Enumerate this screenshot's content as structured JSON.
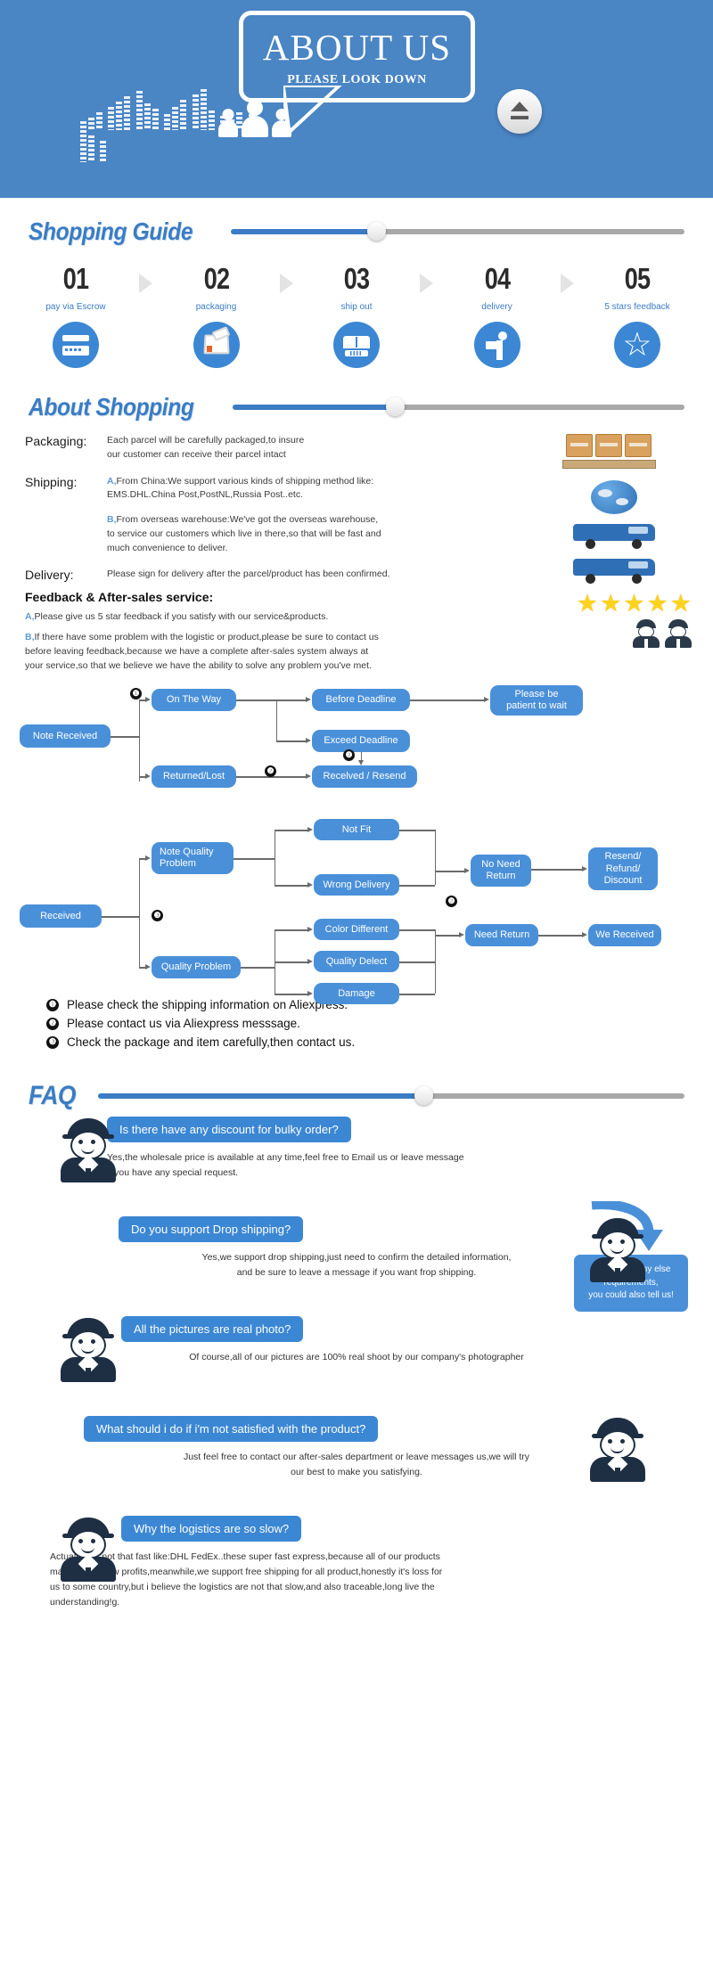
{
  "banner": {
    "title": "ABOUT US",
    "subtitle": "PLEASE LOOK DOWN",
    "eject_icon": "eject-icon",
    "people_icon": "people-group-icon",
    "equalizer_icon": "equalizer-bars-icon",
    "bg_color": "#4a85c4"
  },
  "shopping_guide": {
    "heading": "Shopping Guide",
    "steps": [
      {
        "num": "01",
        "label": "pay via Escrow",
        "icon": "credit-card-icon"
      },
      {
        "num": "02",
        "label": "packaging",
        "icon": "open-box-icon"
      },
      {
        "num": "03",
        "label": "ship out",
        "icon": "bus-icon"
      },
      {
        "num": "04",
        "label": "delivery",
        "icon": "delivery-person-icon"
      },
      {
        "num": "05",
        "label": "5 stars feedback",
        "icon": "star-icon"
      }
    ]
  },
  "about_shopping": {
    "heading": "About Shopping",
    "packaging": {
      "key": "Packaging:",
      "line1": "Each parcel will be carefully packaged,to insure",
      "line2": "our customer can receive their parcel intact"
    },
    "shipping": {
      "key": "Shipping:",
      "a_marker": "A,",
      "a_line1": "From China:We support various kinds of shipping method like:",
      "a_line2": "EMS.DHL.China Post,PostNL,Russia Post..etc.",
      "b_marker": "B,",
      "b_line1": "From overseas warehouse:We've got the overseas warehouse,",
      "b_line2": "to service our customers which live in there,so that will be fast and",
      "b_line3": "much convenience to deliver."
    },
    "delivery": {
      "key": "Delivery:",
      "text": "Please sign for delivery after the parcel/product has been confirmed."
    },
    "feedback": {
      "heading": "Feedback & After-sales service:",
      "a_marker": "A,",
      "a_text": "Please give us 5 star feedback if you satisfy with our service&products.",
      "b_marker": "B,",
      "b_line1": "If there have some problem with the logistic or product,please be sure to contact us",
      "b_line2": "before leaving feedback,because we have a complete after-sales system always at",
      "b_line3": "your service,so that we believe we have the ability to solve any problem you've met."
    },
    "figures": [
      "pallet-boxes-icon",
      "globe-icon",
      "blue-truck-icon",
      "blue-van-icon",
      "five-stars-icon",
      "support-agents-icon"
    ]
  },
  "flowchart1": {
    "nodes": [
      {
        "id": "note_received",
        "label": "Note Received"
      },
      {
        "id": "on_the_way",
        "label": "On The Way"
      },
      {
        "id": "returned_lost",
        "label": "Returned/Lost"
      },
      {
        "id": "before_deadline",
        "label": "Before Deadline"
      },
      {
        "id": "exceed_deadline",
        "label": "Exceed Deadline"
      },
      {
        "id": "received_resend",
        "label": "Recelved / Resend"
      },
      {
        "id": "be_patient",
        "label": "Please be\npatient to wait"
      }
    ],
    "badges": [
      "❶",
      "❷",
      "❷"
    ]
  },
  "flowchart2": {
    "nodes": [
      {
        "id": "received",
        "label": "Received"
      },
      {
        "id": "note_quality_problem",
        "label": "Note Quality\nProblem"
      },
      {
        "id": "quality_problem",
        "label": "Quality Problem"
      },
      {
        "id": "not_fit",
        "label": "Not Fit"
      },
      {
        "id": "wrong_delivery",
        "label": "Wrong Delivery"
      },
      {
        "id": "color_different",
        "label": "Color Different"
      },
      {
        "id": "quality_delect",
        "label": "Quality Delect"
      },
      {
        "id": "damage",
        "label": "Damage"
      },
      {
        "id": "no_need_return",
        "label": "No Need\nReturn"
      },
      {
        "id": "need_return",
        "label": "Need Return"
      },
      {
        "id": "resend_refund_discount",
        "label": "Resend/\nRefund/\nDiscount"
      },
      {
        "id": "we_received",
        "label": "We Received"
      }
    ],
    "badges": [
      "❸",
      "❷"
    ]
  },
  "notes": [
    {
      "bullet": "❶",
      "text": "Please check the shipping information on Aliexpress."
    },
    {
      "bullet": "❷",
      "text": "Please contact us via Aliexpress messsage."
    },
    {
      "bullet": "❸",
      "text": "Check the package and item carefully,then contact us."
    }
  ],
  "callout": {
    "line1": "If you have any else",
    "line2": "requirements,",
    "line3": "you could also tell us!"
  },
  "faq": {
    "heading": "FAQ",
    "items": [
      {
        "question": "Is there have any discount for bulky order?",
        "answer_line1": "Yes,the wholesale price is available at any time,feel free to Email us or leave message",
        "answer_line2": "if you have any special request.",
        "avatar_side": "left",
        "answer_align": "left"
      },
      {
        "question": "Do you support Drop shipping?",
        "answer_line1": "Yes,we support drop shipping,just need to confirm the detailed information,",
        "answer_line2": "and be sure to leave a message if you want frop shipping.",
        "avatar_side": "right",
        "answer_align": "center"
      },
      {
        "question": "All the pictures are real photo?",
        "answer_line1": "Of course,all of our pictures are 100% real shoot by our company's photographer",
        "answer_line2": "",
        "avatar_side": "left",
        "answer_align": "center"
      },
      {
        "question": "What should i do if i'm not satisfied with the product?",
        "answer_line1": "Just feel free to contact our after-sales department or leave messages us,we will try",
        "answer_line2": "our best to make you satisfying.",
        "avatar_side": "right",
        "answer_align": "center"
      },
      {
        "question": "Why the logistics are so slow?",
        "answer_line1": "Actually it is not that fast like:DHL FedEx..these super fast express,because all of our products",
        "answer_line2": "makes really low profits,meanwhile,we support free shipping for all product,honestly it's loss for",
        "answer_line3": "us to some country,but i believe the logistics are not that slow,and also traceable,long live the",
        "answer_line4": "understanding!g.",
        "avatar_side": "left",
        "answer_align": "left"
      }
    ]
  },
  "colors": {
    "brand_blue": "#3b87d4",
    "banner_blue": "#4a85c4",
    "node_blue": "#4a90d9",
    "star_yellow": "#ffd21e",
    "line_gray": "#6b6b6b"
  }
}
